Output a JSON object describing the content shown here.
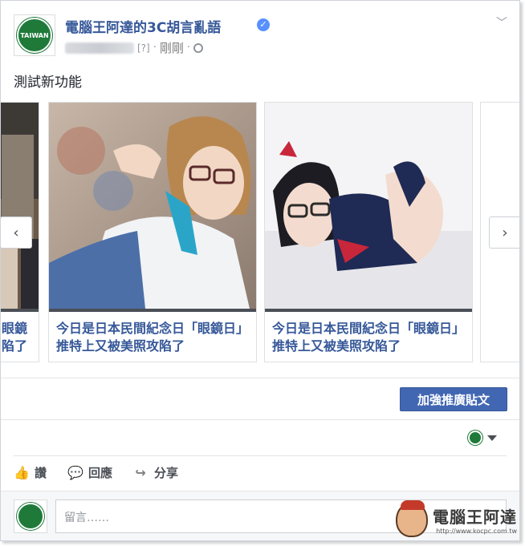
{
  "post": {
    "page_name": "電腦王阿達的3C胡言亂語",
    "unknown_tag": "[?]",
    "time": "剛剛",
    "text": "測試新功能",
    "logo_text": "TAIWAN"
  },
  "carousel": {
    "cards": [
      {
        "caption": "眼鏡\n陷了"
      },
      {
        "caption": "今日是日本民間紀念日「眼鏡日」　推特上又被美照攻陷了"
      },
      {
        "caption": "今日是日本民間紀念日「眼鏡日」　推特上又被美照攻陷了"
      }
    ],
    "prev_label": "‹",
    "next_label": "›"
  },
  "boost": {
    "label": "加強推廣貼文"
  },
  "actions": {
    "like": "讚",
    "comment": "回應",
    "share": "分享"
  },
  "comment_box": {
    "placeholder": "留言……"
  },
  "watermark": {
    "title": "電腦王阿達",
    "url": "http://www.kocpc.com.tw"
  },
  "colors": {
    "link": "#365899",
    "button": "#4267b2"
  }
}
